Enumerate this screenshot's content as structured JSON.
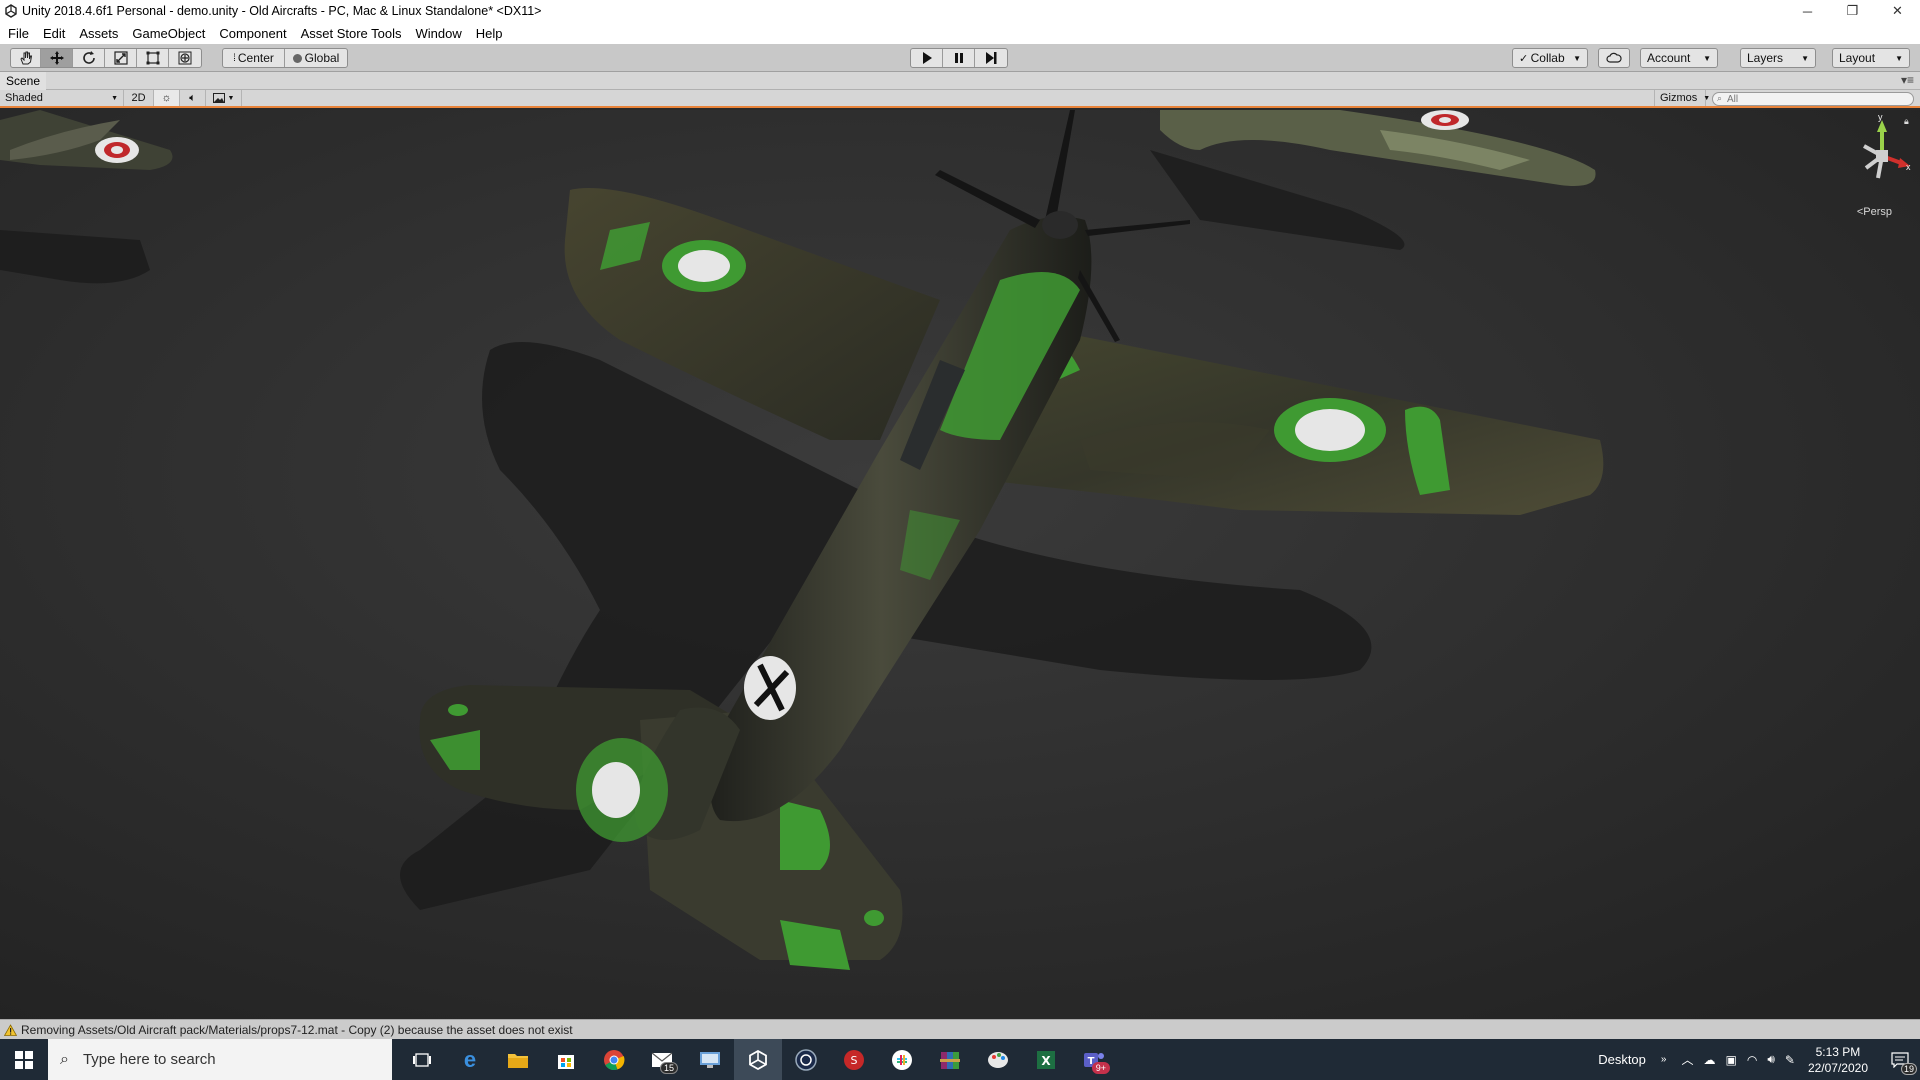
{
  "window": {
    "title": "Unity 2018.4.6f1 Personal - demo.unity - Old Aircrafts - PC, Mac & Linux Standalone* <DX11>",
    "minimize": "─",
    "restore": "❐",
    "close": "✕"
  },
  "menu": [
    "File",
    "Edit",
    "Assets",
    "GameObject",
    "Component",
    "Asset Store Tools",
    "Window",
    "Help"
  ],
  "toolbar": {
    "pivot_label": "Center",
    "space_label": "Global",
    "collab_label": "Collab",
    "account_label": "Account",
    "layers_label": "Layers",
    "layout_label": "Layout"
  },
  "scene_tab": {
    "label": "Scene"
  },
  "scene_bar": {
    "shading_mode": "Shaded",
    "mode_2d": "2D",
    "gizmos_label": "Gizmos",
    "search_placeholder": "All"
  },
  "viewport": {
    "projection_label": "Persp",
    "gizmo_y": "y",
    "gizmo_x": "x"
  },
  "status": {
    "message": "Removing Assets/Old Aircraft pack/Materials/props7-12.mat - Copy (2) because the asset does not exist"
  },
  "taskbar": {
    "search_placeholder": "Type here to search",
    "mail_badge": "15",
    "teams_badge": "9+",
    "desktop_label": "Desktop",
    "time": "5:13 PM",
    "date": "22/07/2020",
    "notification_count": "19"
  },
  "colors": {
    "accent_orange": "#e8833a",
    "camo_green": "#3f9a32",
    "camo_dark": "#2c2f25",
    "roundel_white": "#e6e6e6",
    "roundel_red": "#c0282b"
  }
}
